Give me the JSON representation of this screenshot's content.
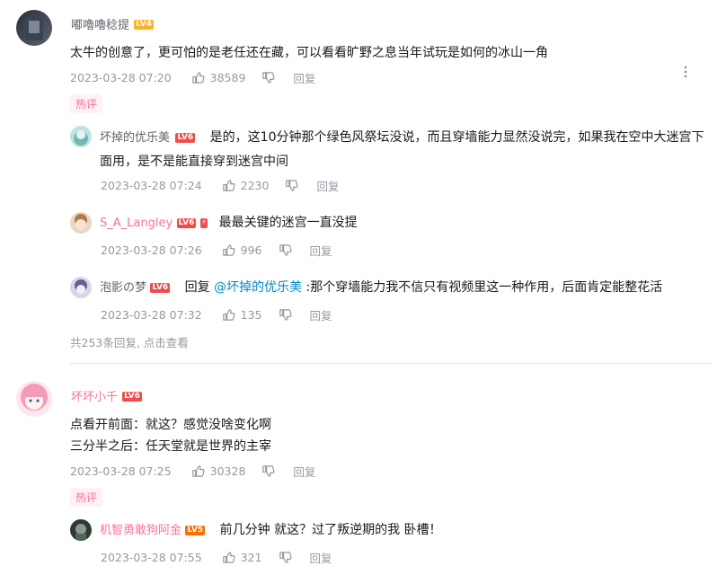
{
  "comments": [
    {
      "user": "嘟嚕嚕稔提",
      "level": "LV4",
      "content": "太牛的创意了，更可怕的是老任还在藏，可以看看旷野之息当年试玩是如何的冰山一角",
      "time": "2023-03-28 07:20",
      "likes": "38589",
      "reply_label": "回复",
      "hot_label": "热评",
      "replies": [
        {
          "user": "坏掉的优乐美",
          "level": "LV6",
          "content": "是的，这10分钟那个绿色风祭坛没说，而且穿墙能力显然没说完，如果我在空中大迷宫下面用，是不是能直接穿到迷宫中间",
          "time": "2023-03-28 07:24",
          "likes": "2230",
          "reply_label": "回复"
        },
        {
          "user": "S_A_Langley",
          "level": "LV6",
          "content": "最最关键的迷宫一直没提",
          "time": "2023-03-28 07:26",
          "likes": "996",
          "reply_label": "回复"
        },
        {
          "user": "泡影の梦",
          "level": "LV6",
          "content_prefix": "回复 ",
          "mention": "@坏掉的优乐美",
          "content": " :那个穿墙能力我不信只有视频里这一种作用，后面肯定能整花活",
          "time": "2023-03-28 07:32",
          "likes": "135",
          "reply_label": "回复"
        }
      ],
      "more_replies": "共253条回复, 点击查看"
    },
    {
      "user": "坏坏小千",
      "level": "LV6",
      "content_lines": [
        "点看开前面：就这？感觉没啥变化啊",
        "三分半之后：任天堂就是世界的主宰"
      ],
      "time": "2023-03-28 07:25",
      "likes": "30328",
      "reply_label": "回复",
      "hot_label": "热评",
      "replies": [
        {
          "user": "机智勇敢狗阿金",
          "level": "LV5",
          "content": "前几分钟 就这？过了叛逆期的我 卧槽！",
          "time": "2023-03-28 07:55",
          "likes": "321",
          "reply_label": "回复"
        }
      ]
    }
  ],
  "icons": {
    "more": "more-vertical-icon",
    "like": "thumb-up-icon",
    "dislike": "thumb-down-icon"
  },
  "colors": {
    "accent": "#fb7299",
    "mention": "#008ac5",
    "lv4": "#ffb027",
    "lv5": "#ff6c00",
    "lv6": "#f04c49"
  }
}
